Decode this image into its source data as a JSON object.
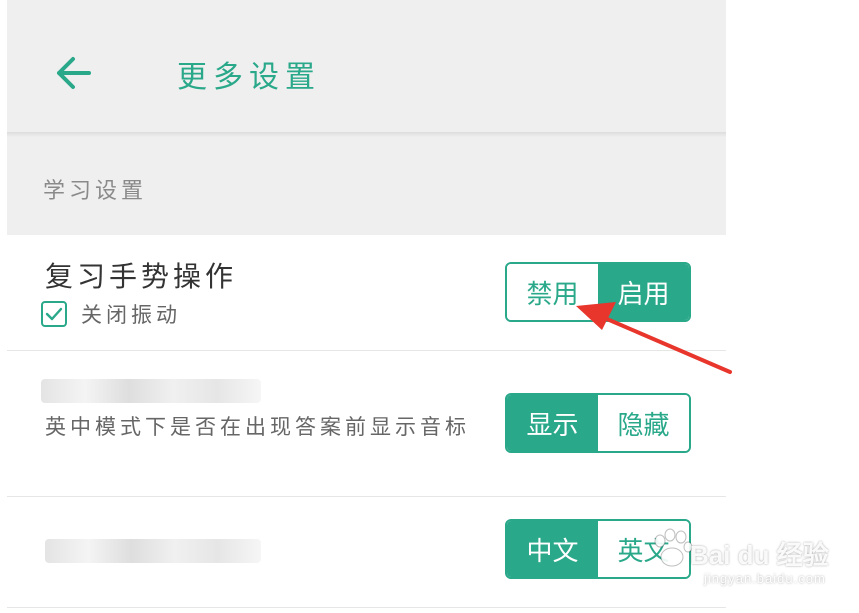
{
  "header": {
    "title": "更多设置",
    "back_icon": "arrow-left-icon"
  },
  "section": {
    "label": "学习设置"
  },
  "rows": [
    {
      "title": "复习手势操作",
      "checkbox_label": "关闭振动",
      "checkbox_checked": true,
      "options": [
        "禁用",
        "启用"
      ],
      "selected": "启用"
    },
    {
      "description": "英中模式下是否在出现答案前显示音标",
      "options": [
        "显示",
        "隐藏"
      ],
      "selected": "显示"
    },
    {
      "options": [
        "中文",
        "英文"
      ],
      "selected": "中文"
    }
  ],
  "watermark": {
    "main": "Bai du 经验",
    "sub": "jingyan.baidu.com"
  },
  "colors": {
    "accent": "#2aa88a",
    "annotation_arrow": "#e8362d"
  }
}
